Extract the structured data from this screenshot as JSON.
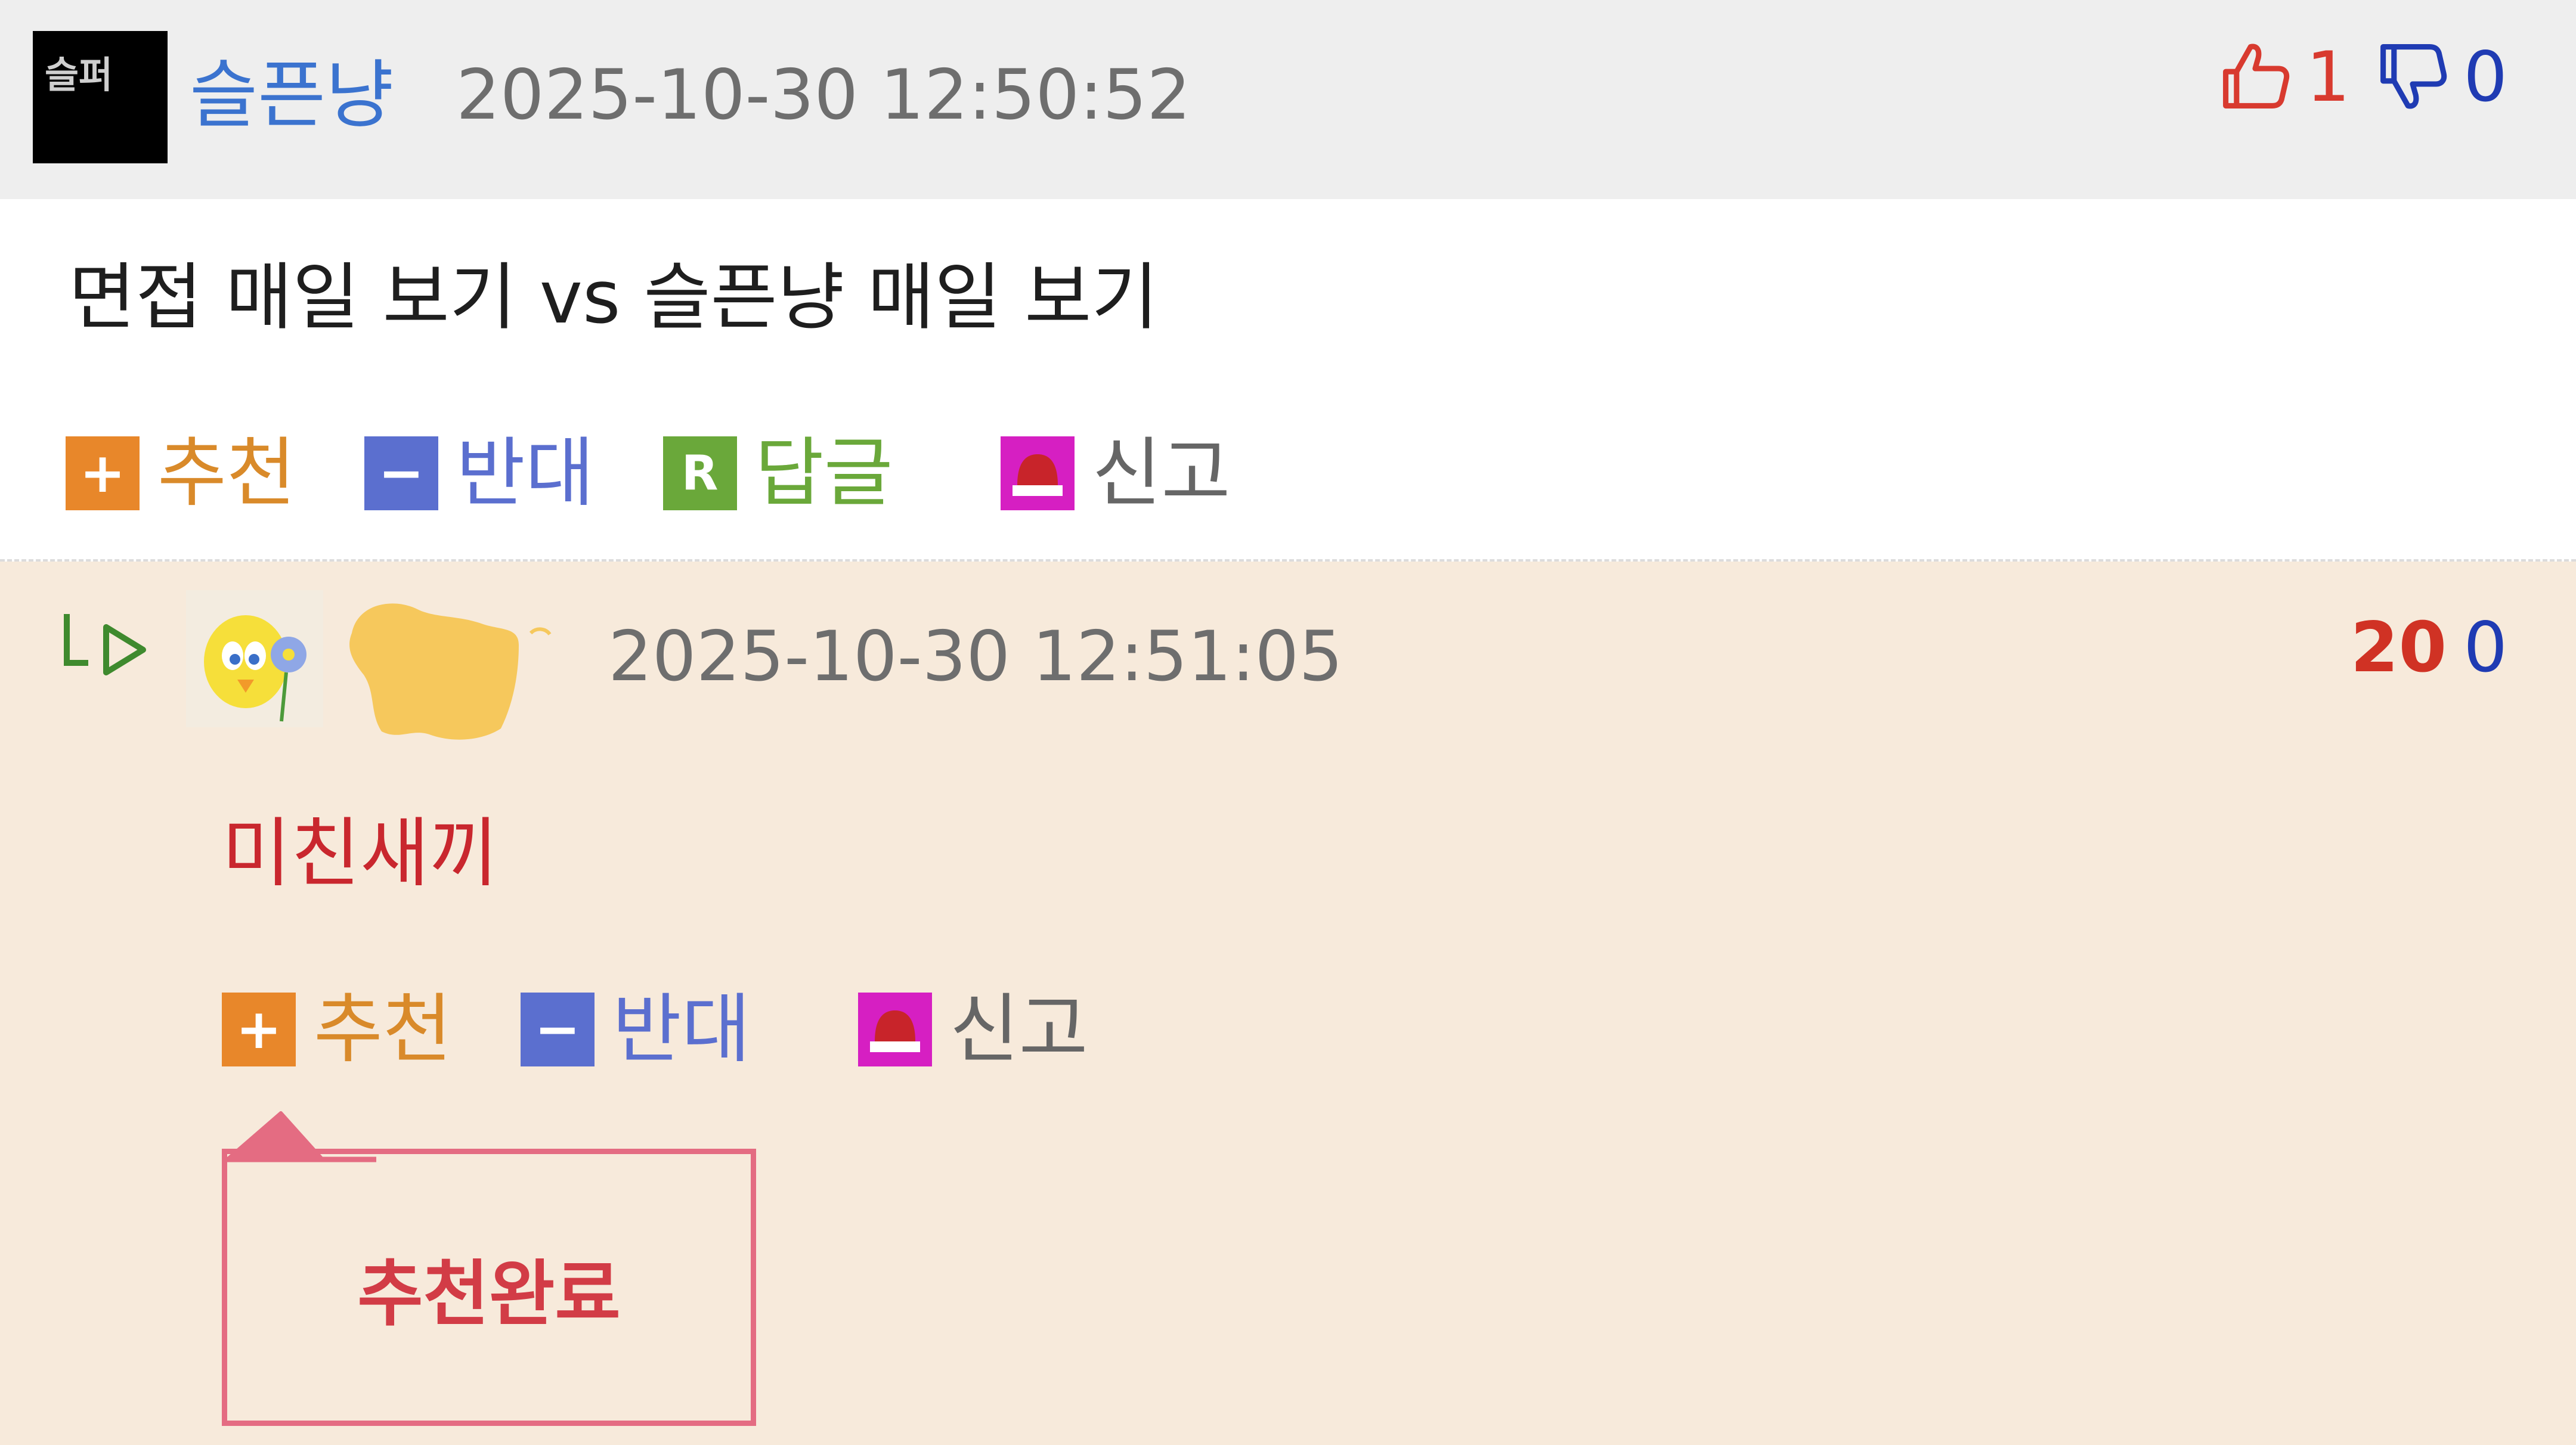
{
  "post": {
    "author": "슬픈냥",
    "avatar_text": "슬퍼",
    "timestamp": "2025-10-30 12:50:52",
    "upvotes": "1",
    "downvotes": "0",
    "content": "면접 매일 보기 vs 슬픈냥 매일 보기",
    "actions": {
      "recommend": "추천",
      "oppose": "반대",
      "reply": "답글",
      "report": "신고"
    }
  },
  "reply": {
    "timestamp": "2025-10-30 12:51:05",
    "upvotes": "20",
    "downvotes": "0",
    "content": "미친새끼",
    "actions": {
      "recommend": "추천",
      "oppose": "반대",
      "report": "신고"
    },
    "recommend_popup": "추천완료"
  },
  "icons": {
    "recommend": "plus-icon",
    "oppose": "minus-icon",
    "reply": "reply-r-icon",
    "report": "siren-icon",
    "thumbs_up": "thumbs-up-icon",
    "thumbs_down": "thumbs-down-icon",
    "reply_arrow": "reply-arrow-icon"
  },
  "colors": {
    "author_blue": "#3b73cf",
    "upvote_red": "#d83a2f",
    "downvote_blue": "#1f3bb3",
    "recommend_orange": "#e8872a",
    "oppose_blue": "#5b6fcf",
    "reply_green": "#6aa83a",
    "report_magenta": "#d61fc2",
    "reply_bg": "#f7eadb",
    "popup_border": "#e46c82",
    "popup_text": "#d23c46"
  }
}
